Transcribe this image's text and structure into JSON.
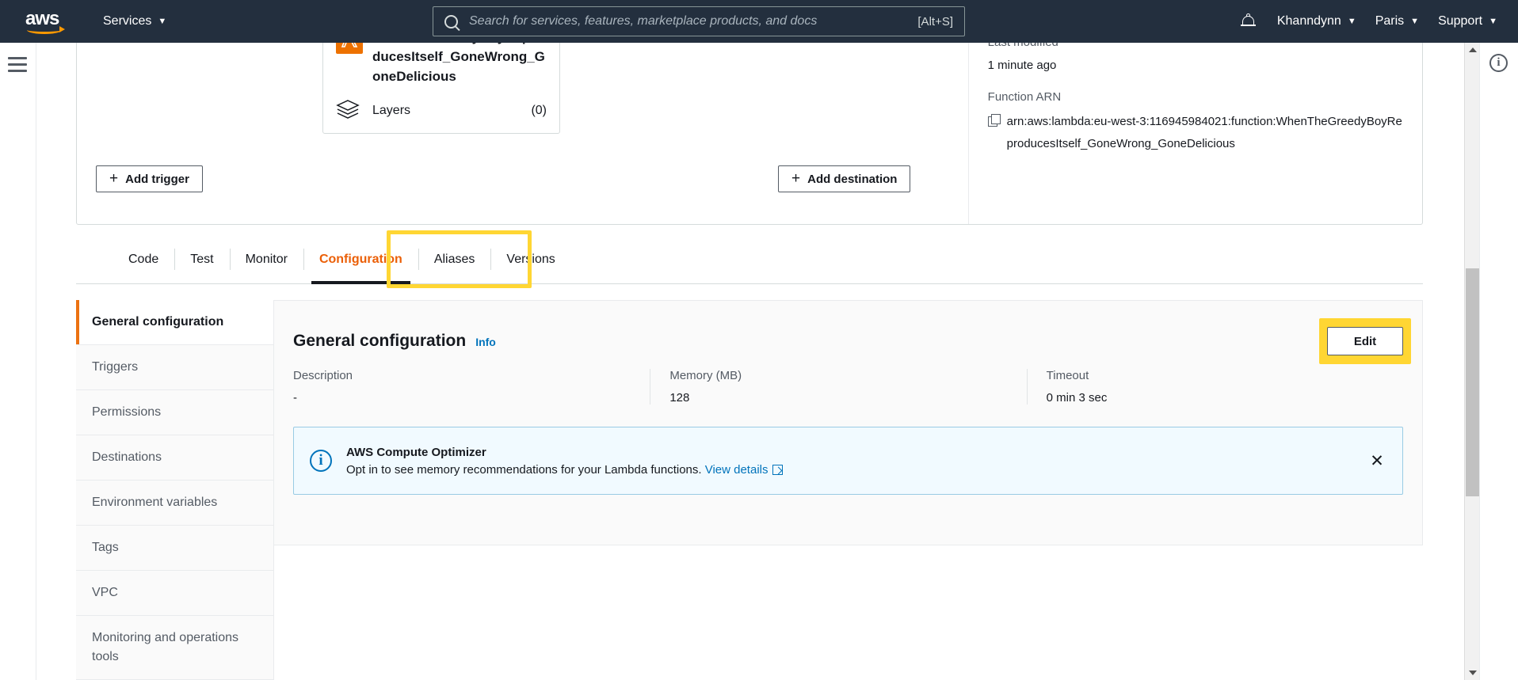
{
  "topnav": {
    "logo_text": "aws",
    "services_label": "Services",
    "caret": "▼",
    "search": {
      "placeholder": "Search for services, features, marketplace products, and docs",
      "value": "",
      "shortcut": "[Alt+S]"
    },
    "account_label": "Khanndynn",
    "region_label": "Paris",
    "support_label": "Support"
  },
  "overview": {
    "function_name": "WhenTheGreedyBoyReproducesItself_GoneWrong_GoneDelicious",
    "function_name_visible": "oducesItself_GoneWrong_GoneDelicious",
    "layers_label": "Layers",
    "layers_count": "(0)",
    "add_trigger_label": "Add trigger",
    "add_destination_label": "Add destination",
    "plus_glyph": "+",
    "last_modified_label": "Last modified",
    "last_modified_value": "1 minute ago",
    "function_arn_label": "Function ARN",
    "function_arn_value": "arn:aws:lambda:eu-west-3:116945984021:function:WhenTheGreedyBoyReproducesItself_GoneWrong_GoneDelicious"
  },
  "tabs": [
    {
      "label": "Code",
      "active": false
    },
    {
      "label": "Test",
      "active": false
    },
    {
      "label": "Monitor",
      "active": false
    },
    {
      "label": "Configuration",
      "active": true
    },
    {
      "label": "Aliases",
      "active": false
    },
    {
      "label": "Versions",
      "active": false
    }
  ],
  "sidebar": {
    "items": [
      {
        "label": "General configuration",
        "active": true
      },
      {
        "label": "Triggers",
        "active": false
      },
      {
        "label": "Permissions",
        "active": false
      },
      {
        "label": "Destinations",
        "active": false
      },
      {
        "label": "Environment variables",
        "active": false
      },
      {
        "label": "Tags",
        "active": false
      },
      {
        "label": "VPC",
        "active": false
      },
      {
        "label": "Monitoring and operations tools",
        "active": false
      }
    ]
  },
  "panel": {
    "title": "General configuration",
    "info_label": "Info",
    "edit_label": "Edit",
    "properties": [
      {
        "label": "Description",
        "value": "-"
      },
      {
        "label": "Memory (MB)",
        "value": "128"
      },
      {
        "label": "Timeout",
        "value": "0 min  3 sec"
      }
    ],
    "flashbar": {
      "title": "AWS Compute Optimizer",
      "body": "Opt in to see memory recommendations for your Lambda functions.",
      "link_label": "View details",
      "close_glyph": "✕"
    }
  },
  "colors": {
    "nav_background": "#232f3e",
    "accent_orange": "#ec7211",
    "active_tab": "#eb5f07",
    "link_blue": "#0073bb",
    "highlight_yellow": "#ffd633",
    "lambda_icon": "#ed7100"
  },
  "icons": {
    "search": "search-icon",
    "bell": "notifications-bell-icon",
    "hamburger": "hamburger-menu-icon",
    "info": "info-circle-icon",
    "copy": "copy-icon",
    "lambda": "lambda-service-icon",
    "layers": "layers-icon",
    "external": "external-link-icon"
  }
}
